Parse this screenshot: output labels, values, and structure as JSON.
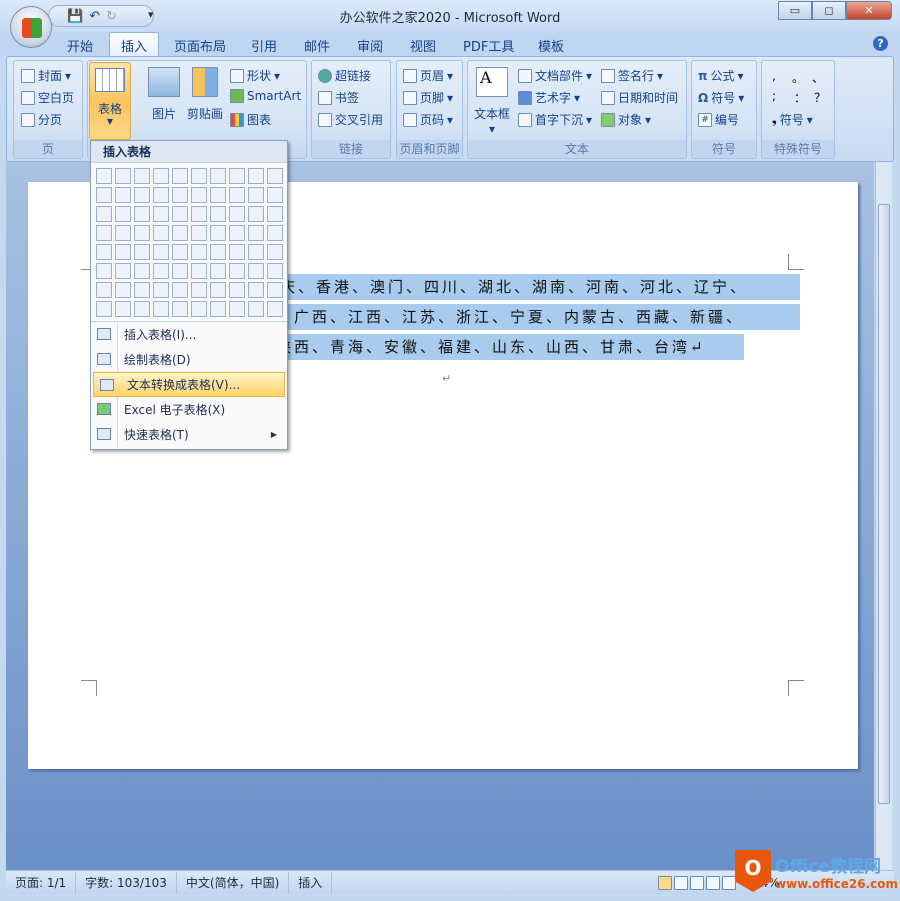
{
  "window": {
    "title": "办公软件之家2020 - Microsoft Word",
    "minimize": "▭",
    "restore": "◻",
    "close": "✕"
  },
  "qat": {
    "save": "💾",
    "undo": "↶",
    "redo": "↻",
    "more": "▾"
  },
  "tabs": [
    "开始",
    "插入",
    "页面布局",
    "引用",
    "邮件",
    "审阅",
    "视图",
    "PDF工具",
    "模板"
  ],
  "active_tab": "插入",
  "help": "?",
  "ribbon": {
    "page_group": {
      "label": "页",
      "items": [
        "封面",
        "空白页",
        "分页"
      ]
    },
    "table": {
      "label": "表格"
    },
    "illustrations": {
      "picture": "图片",
      "clipart": "剪贴画",
      "shapes": "形状",
      "smartart": "SmartArt",
      "chart": "图表"
    },
    "links": {
      "label": "链接",
      "items": [
        "超链接",
        "书签",
        "交叉引用"
      ]
    },
    "header_footer": {
      "label": "页眉和页脚",
      "items": [
        "页眉",
        "页脚",
        "页码"
      ]
    },
    "text": {
      "label": "文本",
      "textbox": "文本框",
      "items": [
        "文档部件",
        "艺术字",
        "首字下沉",
        "签名行",
        "日期和时间",
        "对象"
      ]
    },
    "symbols": {
      "label": "符号",
      "items": [
        "公式",
        "符号",
        "编号"
      ]
    },
    "special": {
      "label": "特殊符号",
      "chars": [
        ",",
        "。",
        "、",
        ";",
        "：",
        "？"
      ],
      "symbol": "符号"
    }
  },
  "menu": {
    "header": "插入表格",
    "items": [
      {
        "label": "插入表格(I)..."
      },
      {
        "label": "绘制表格(D)"
      },
      {
        "label": "文本转换成表格(V)...",
        "highlighted": true
      },
      {
        "label": "Excel 电子表格(X)"
      },
      {
        "label": "快速表格(T)",
        "submenu": true
      }
    ]
  },
  "document": {
    "lines": [
      "庆、香港、澳门、四川、湖北、湖南、河南、河北、辽宁、",
      "广西、江西、江苏、浙江、宁夏、内蒙古、西藏、新疆、",
      "陕西、青海、安徽、福建、山东、山西、甘肃、台湾↵"
    ],
    "empty_para": "↵"
  },
  "status": {
    "page": "页面: 1/1",
    "words": "字数: 103/103",
    "language": "中文(简体，中国)",
    "mode": "插入",
    "zoom": "74%"
  },
  "watermark": {
    "brand": "Office教程网",
    "url": "www.office26.com"
  }
}
